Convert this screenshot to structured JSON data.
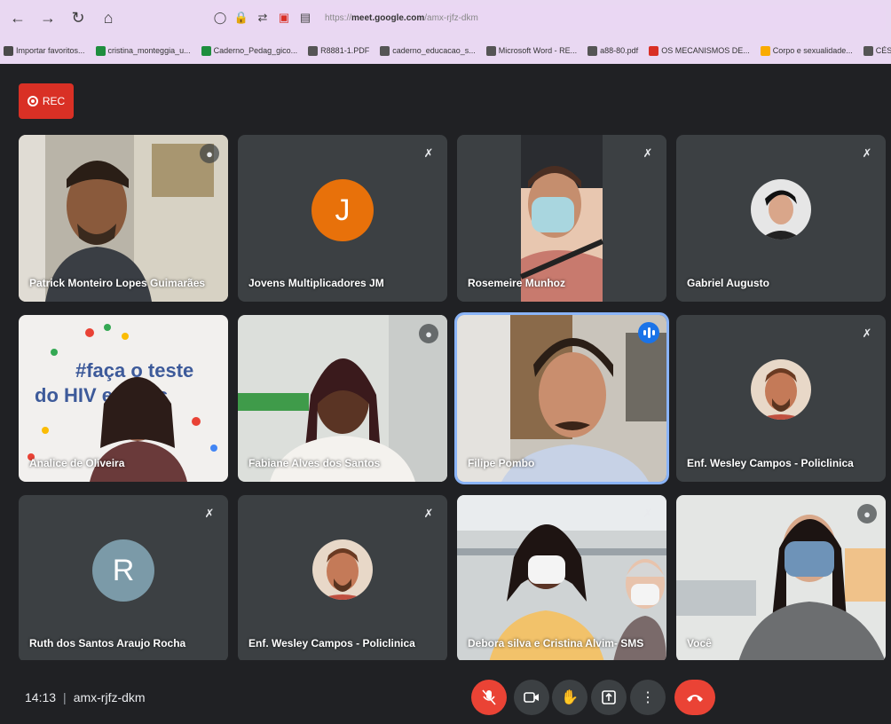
{
  "browser": {
    "url_prefix": "https://",
    "url_domain": "meet.google.com",
    "url_path": "/amx-rjfz-dkm",
    "bookmarks": [
      {
        "label": "Importar favoritos...",
        "color": "#4a4a4a"
      },
      {
        "label": "cristina_monteggia_u...",
        "color": "#1e8e3e"
      },
      {
        "label": "Caderno_Pedag_gico...",
        "color": "#1e8e3e"
      },
      {
        "label": "R8881-1.PDF",
        "color": "#555"
      },
      {
        "label": "caderno_educacao_s...",
        "color": "#555"
      },
      {
        "label": "Microsoft Word - RE...",
        "color": "#555"
      },
      {
        "label": "a88-80.pdf",
        "color": "#555"
      },
      {
        "label": "OS MECANISMOS DE...",
        "color": "#d93025"
      },
      {
        "label": "Corpo e sexualidade...",
        "color": "#f9ab00"
      },
      {
        "label": "CÉSAR APARECI",
        "color": "#555"
      }
    ]
  },
  "meeting": {
    "rec_label": "REC",
    "time": "14:13",
    "separator": "|",
    "code": "amx-rjfz-dkm"
  },
  "participants": [
    {
      "name": "Patrick Monteiro Lopes Guimarães"
    },
    {
      "name": "Jovens Multiplicadores JM",
      "initial": "J",
      "color": "#e8710a"
    },
    {
      "name": "Rosemeire Munhoz"
    },
    {
      "name": "Gabriel Augusto"
    },
    {
      "name": "Analice de Oliveira",
      "banner_line1": "#faça o teste",
      "banner_line2": "do HIV e sífilis"
    },
    {
      "name": "Fabiane Alves dos Santos"
    },
    {
      "name": "Filipe Pombo"
    },
    {
      "name": "Enf. Wesley Campos - Policlinica"
    },
    {
      "name": "Ruth dos Santos Araujo Rocha",
      "initial": "R",
      "color": "#7b9aa8"
    },
    {
      "name": "Enf. Wesley Campos - Policlinica"
    },
    {
      "name": "Debora silva e Cristina Alvim- SMS"
    },
    {
      "name": "Você"
    }
  ]
}
